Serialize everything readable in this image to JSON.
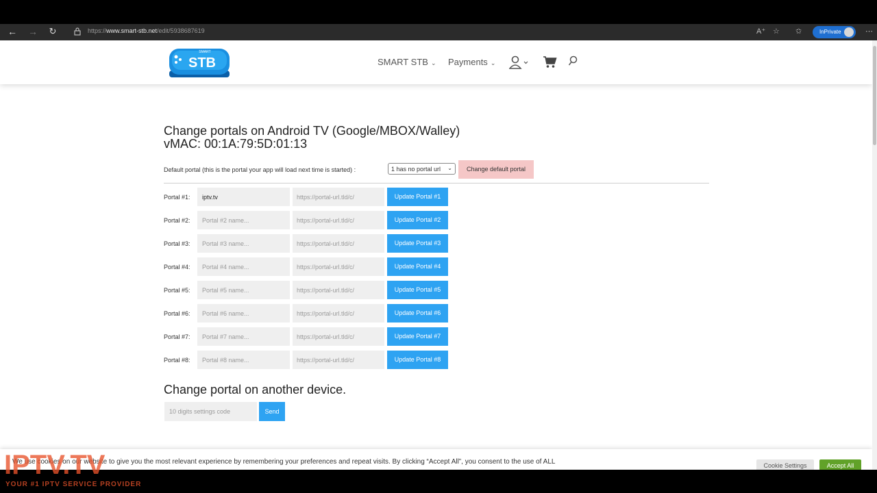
{
  "browser": {
    "url_prefix": "https://",
    "url_host": "www.smart-stb.net",
    "url_path": "/edit/5938687619",
    "inprivate_label": "InPrivate"
  },
  "header": {
    "logo_top_text": "SMART",
    "logo_text": "STB",
    "menu": [
      {
        "label": "SMART STB"
      },
      {
        "label": "Payments"
      }
    ]
  },
  "main": {
    "title_line1": "Change portals on Android TV (Google/MBOX/Walley)",
    "title_line2": "vMAC: 00:1A:79:5D:01:13",
    "default_portal_label": "Default portal (this is the portal your app will load next time is started) :",
    "default_portal_value": "1 has no portal url",
    "change_default_button": "Change default portal",
    "portals": [
      {
        "label": "Portal #1:",
        "name_value": "iptv.tv",
        "name_placeholder": "",
        "url_placeholder": "https://portal-url.tld/c/",
        "button": "Update Portal #1"
      },
      {
        "label": "Portal #2:",
        "name_value": "",
        "name_placeholder": "Portal #2 name...",
        "url_placeholder": "https://portal-url.tld/c/",
        "button": "Update Portal #2"
      },
      {
        "label": "Portal #3:",
        "name_value": "",
        "name_placeholder": "Portal #3 name...",
        "url_placeholder": "https://portal-url.tld/c/",
        "button": "Update Portal #3"
      },
      {
        "label": "Portal #4:",
        "name_value": "",
        "name_placeholder": "Portal #4 name...",
        "url_placeholder": "https://portal-url.tld/c/",
        "button": "Update Portal #4"
      },
      {
        "label": "Portal #5:",
        "name_value": "",
        "name_placeholder": "Portal #5 name...",
        "url_placeholder": "https://portal-url.tld/c/",
        "button": "Update Portal #5"
      },
      {
        "label": "Portal #6:",
        "name_value": "",
        "name_placeholder": "Portal #6 name...",
        "url_placeholder": "https://portal-url.tld/c/",
        "button": "Update Portal #6"
      },
      {
        "label": "Portal #7:",
        "name_value": "",
        "name_placeholder": "Portal #7 name...",
        "url_placeholder": "https://portal-url.tld/c/",
        "button": "Update Portal #7"
      },
      {
        "label": "Portal #8:",
        "name_value": "",
        "name_placeholder": "Portal #8 name...",
        "url_placeholder": "https://portal-url.tld/c/",
        "button": "Update Portal #8"
      }
    ],
    "other_device_title": "Change portal on another device.",
    "settings_code_placeholder": "10 digits settings code",
    "send_button": "Send"
  },
  "cookie_banner": {
    "text": "We use cookies on our website to give you the most relevant experience by remembering your preferences and repeat visits. By clicking “Accept All”, you consent to the use of ALL",
    "settings_button": "Cookie Settings",
    "accept_button": "Accept All"
  },
  "watermark": {
    "brand": "IPTV.TV",
    "tagline": "YOUR #1 IPTV SERVICE PROVIDER"
  },
  "colors": {
    "primary_button": "#2ea3f2",
    "default_button": "#f5c7c7",
    "accept_button": "#61a229",
    "watermark": "#e8532b"
  }
}
